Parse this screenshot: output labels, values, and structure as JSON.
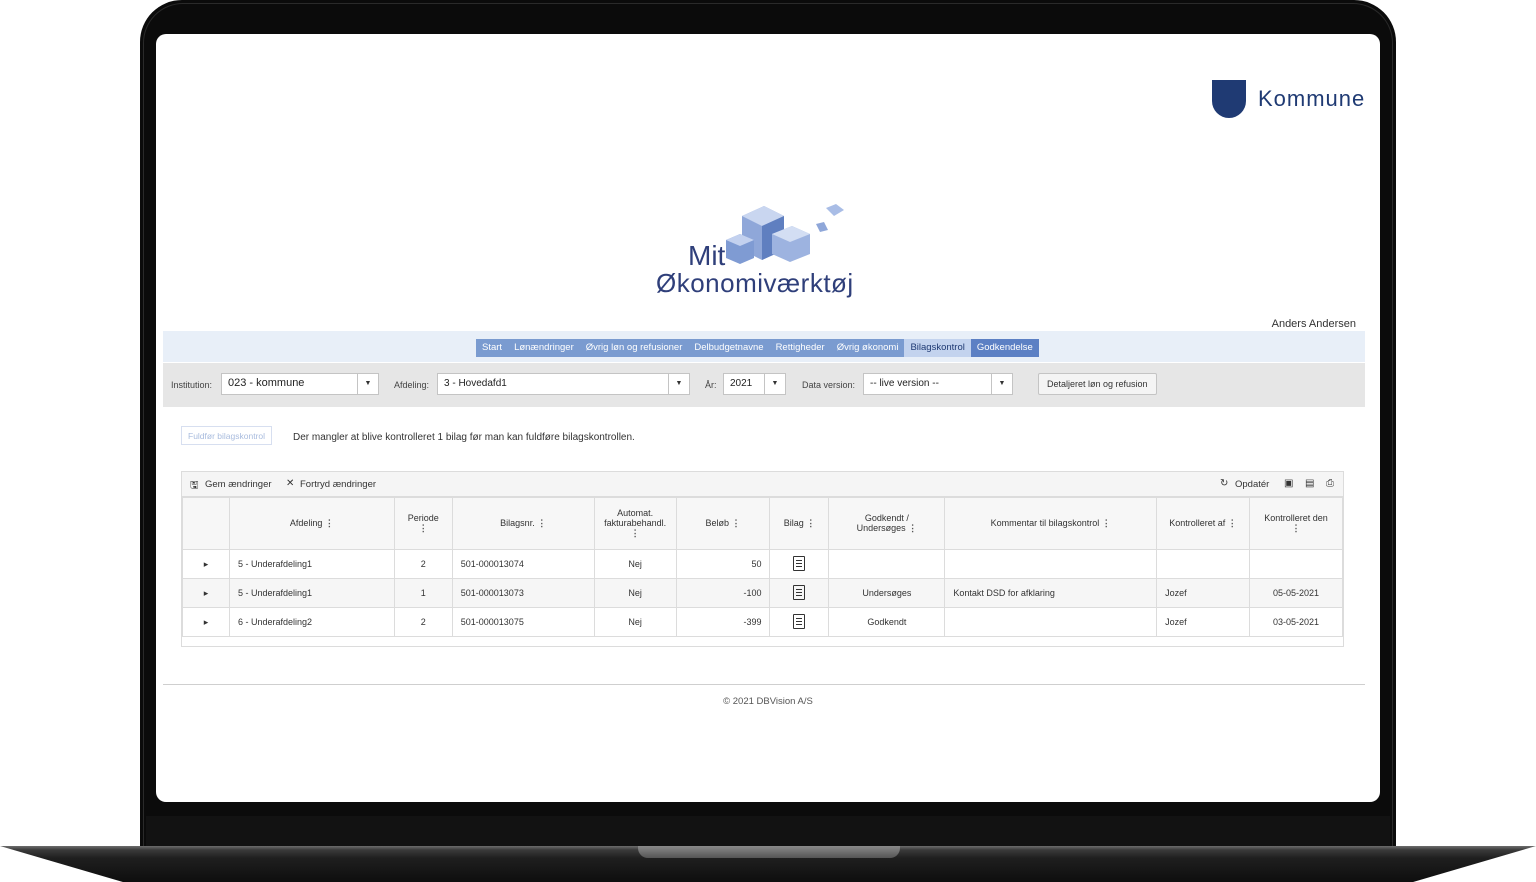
{
  "brand": {
    "name": "Kommune"
  },
  "logo": {
    "line1": "Mit",
    "line2": "Økonomiværktøj"
  },
  "user": {
    "name": "Anders Andersen"
  },
  "nav": [
    {
      "label": "Start",
      "active": false
    },
    {
      "label": "Lønændringer",
      "active": false
    },
    {
      "label": "Øvrig løn og refusioner",
      "active": false
    },
    {
      "label": "Delbudgetnavne",
      "active": false
    },
    {
      "label": "Rettigheder",
      "active": false
    },
    {
      "label": "Øvrig økonomi",
      "active": false
    },
    {
      "label": "Bilagskontrol",
      "active": true
    },
    {
      "label": "Godkendelse",
      "active": false
    }
  ],
  "filters": {
    "institution_label": "Institution:",
    "institution_value": "023 - kommune",
    "afdeling_label": "Afdeling:",
    "afdeling_value": "3 - Hovedafd1",
    "aar_label": "År:",
    "aar_value": "2021",
    "dataversion_label": "Data version:",
    "dataversion_value": "-- live version --",
    "detail_button": "Detaljeret løn og refusion"
  },
  "control": {
    "complete_button": "Fuldfør bilagskontrol",
    "notice": "Der mangler at blive kontrolleret 1 bilag før man kan fuldføre bilagskontrollen."
  },
  "toolbar": {
    "save": "Gem ændringer",
    "undo": "Fortryd ændringer",
    "refresh": "Opdatér",
    "icons": [
      "excel-icon",
      "pdf-icon",
      "print-icon"
    ]
  },
  "table": {
    "headers": {
      "afdeling": "Afdeling",
      "periode": "Periode",
      "bilagsnr": "Bilagsnr.",
      "automat_1": "Automat.",
      "automat_2": "fakturabehandl.",
      "beloeb": "Beløb",
      "bilag": "Bilag",
      "godkendt_1": "Godkendt /",
      "godkendt_2": "Undersøges",
      "kommentar": "Kommentar til bilagskontrol",
      "kontrolleret_af": "Kontrolleret af",
      "kontrolleret_den": "Kontrolleret den"
    },
    "rows": [
      {
        "afdeling": "5 - Underafdeling1",
        "periode": "2",
        "bilagsnr": "501-000013074",
        "automat": "Nej",
        "beloeb": "50",
        "status": "",
        "kommentar": "",
        "af": "",
        "den": ""
      },
      {
        "afdeling": "5 - Underafdeling1",
        "periode": "1",
        "bilagsnr": "501-000013073",
        "automat": "Nej",
        "beloeb": "-100",
        "status": "Undersøges",
        "kommentar": "Kontakt DSD for afklaring",
        "af": "Jozef",
        "den": "05-05-2021"
      },
      {
        "afdeling": "6 - Underafdeling2",
        "periode": "2",
        "bilagsnr": "501-000013075",
        "automat": "Nej",
        "beloeb": "-399",
        "status": "Godkendt",
        "kommentar": "",
        "af": "Jozef",
        "den": "03-05-2021"
      }
    ]
  },
  "footer": {
    "text": "© 2021 DBVision A/S"
  },
  "colors": {
    "brand": "#1f3a73",
    "nav": "#7a9bd0",
    "nav_active": "#c3d3ee"
  }
}
